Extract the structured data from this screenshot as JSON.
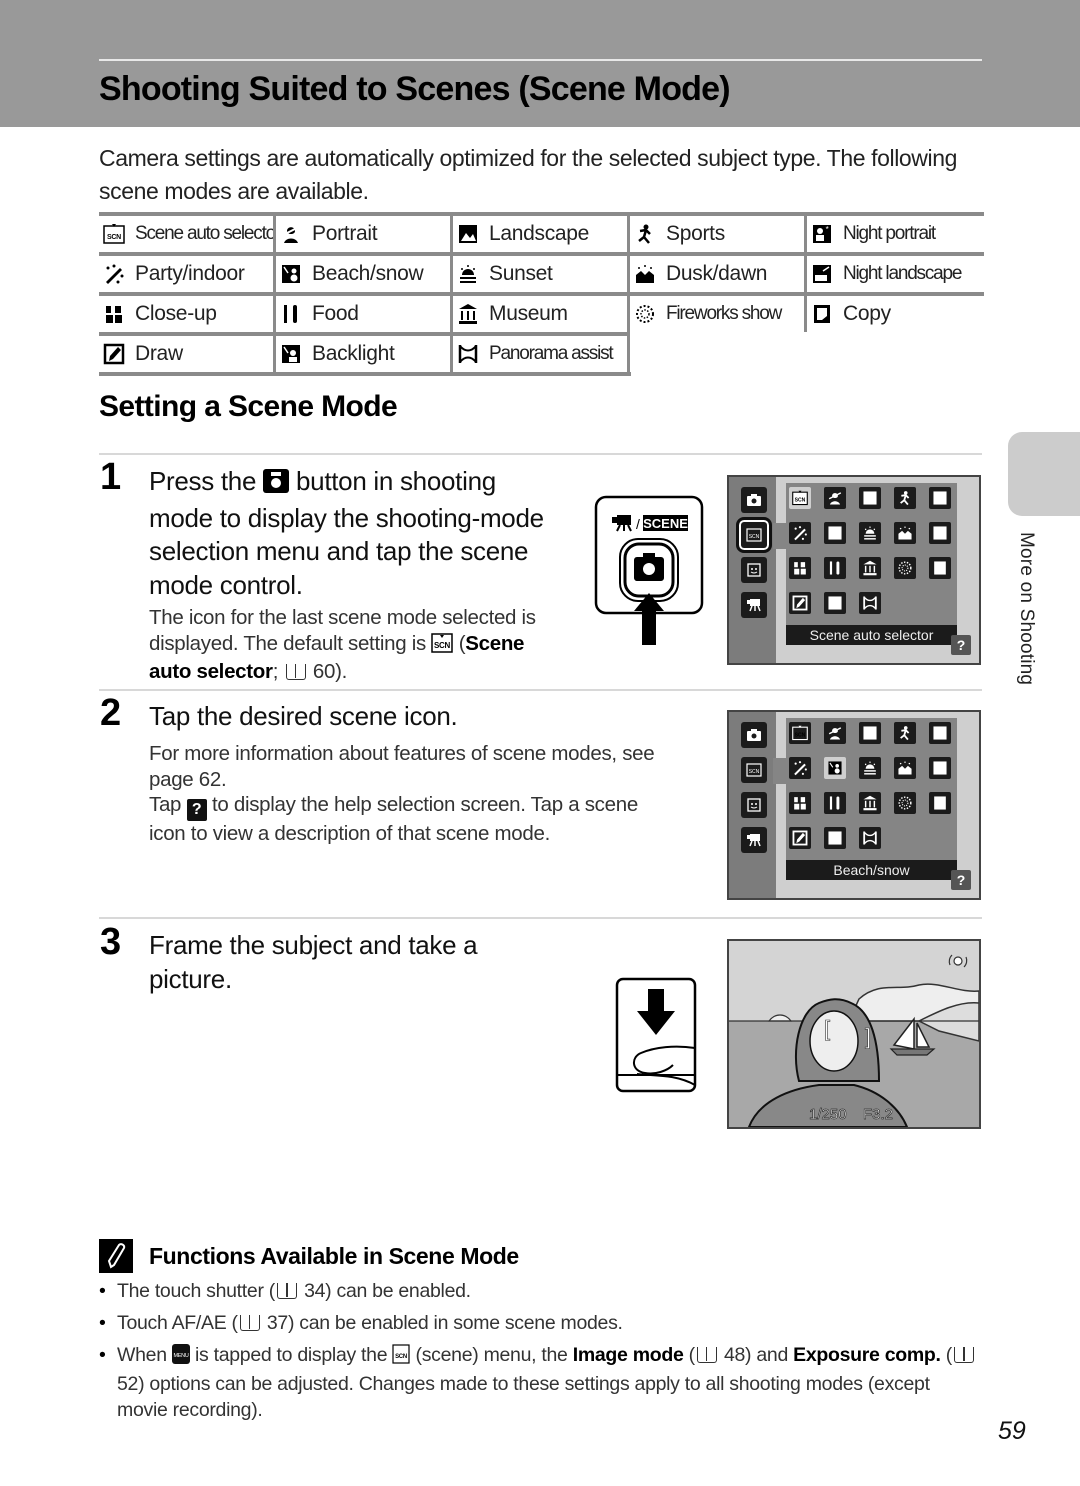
{
  "header": {
    "title": "Shooting Suited to Scenes (Scene Mode)"
  },
  "intro": "Camera settings are automatically optimized for the selected subject type. The following scene modes are available.",
  "scene_modes": [
    [
      {
        "label": "Scene auto selector",
        "icon": "scene-auto-selector-icon"
      },
      {
        "label": "Portrait",
        "icon": "portrait-icon"
      },
      {
        "label": "Landscape",
        "icon": "landscape-icon"
      },
      {
        "label": "Sports",
        "icon": "sports-icon"
      },
      {
        "label": "Night portrait",
        "icon": "night-portrait-icon"
      }
    ],
    [
      {
        "label": "Party/indoor",
        "icon": "party-indoor-icon"
      },
      {
        "label": "Beach/snow",
        "icon": "beach-snow-icon"
      },
      {
        "label": "Sunset",
        "icon": "sunset-icon"
      },
      {
        "label": "Dusk/dawn",
        "icon": "dusk-dawn-icon"
      },
      {
        "label": "Night landscape",
        "icon": "night-landscape-icon"
      }
    ],
    [
      {
        "label": "Close-up",
        "icon": "close-up-icon"
      },
      {
        "label": "Food",
        "icon": "food-icon"
      },
      {
        "label": "Museum",
        "icon": "museum-icon"
      },
      {
        "label": "Fireworks show",
        "icon": "fireworks-icon"
      },
      {
        "label": "Copy",
        "icon": "copy-icon"
      }
    ],
    [
      {
        "label": "Draw",
        "icon": "draw-icon"
      },
      {
        "label": "Backlight",
        "icon": "backlight-icon"
      },
      {
        "label": "Panorama assist",
        "icon": "panorama-assist-icon"
      }
    ]
  ],
  "section": {
    "title": "Setting a Scene Mode"
  },
  "steps": [
    {
      "number": "1",
      "head_lines": [
        "Press the",
        "button in shooting",
        "mode to display the shooting-mode",
        "selection menu and tap the scene",
        "mode control."
      ],
      "body_line1": "The icon for the last scene mode selected is",
      "body_line2_pre": "displayed. The default setting is",
      "body_line2_bold": "Scene",
      "body_line3_bold": "auto selector",
      "body_line3_ref": "60).",
      "button_label": "SCENE",
      "lcd_caption": "Scene auto selector",
      "help_label": "?"
    },
    {
      "number": "2",
      "head": "Tap the desired scene icon.",
      "body_line1": "For more information about features of scene modes, see",
      "body_line2": "page 62.",
      "body_line3_pre": "Tap",
      "body_line3_post": "to display the help selection screen. Tap a scene",
      "body_line4": "icon to view a description of that scene mode.",
      "help_label": "?",
      "lcd_caption": "Beach/snow"
    },
    {
      "number": "3",
      "head_line1": "Frame the subject and take a",
      "head_line2": "picture.",
      "shutter_speed": "1/250",
      "aperture": "F3.2"
    }
  ],
  "tip": {
    "title": "Functions Available in Scene Mode",
    "items": [
      {
        "pre": "The touch shutter (",
        "ref": "34) can be enabled."
      },
      {
        "pre": "Touch AF/AE (",
        "ref": "37) can be enabled in some scene modes."
      },
      {
        "pre": "When",
        "mid1": "is tapped to display the",
        "mid2": "(scene) menu, the",
        "bold1": "Image mode",
        "ref1": "48) and",
        "bold2": "Exposure comp.",
        "ref2": "52) options can be adjusted. Changes made to these settings apply to all shooting modes (except movie recording)."
      }
    ]
  },
  "side_tab": {
    "label": "More on Shooting"
  },
  "page_number": "59"
}
